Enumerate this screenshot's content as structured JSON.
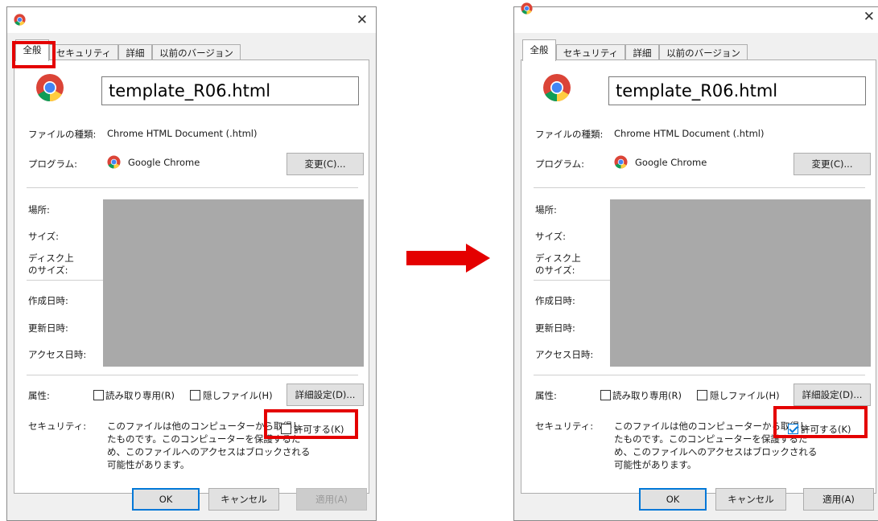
{
  "dialog": {
    "close_glyph": "✕",
    "tabs": [
      "全般",
      "セキュリティ",
      "詳細",
      "以前のバージョン"
    ],
    "file_name": "template_R06.html",
    "labels": {
      "file_type": "ファイルの種類:",
      "program": "プログラム:",
      "location": "場所:",
      "size": "サイズ:",
      "size_on_disk_1": "ディスク上",
      "size_on_disk_2": "のサイズ:",
      "created": "作成日時:",
      "modified": "更新日時:",
      "accessed": "アクセス日時:",
      "attributes": "属性:",
      "security": "セキュリティ:"
    },
    "file_type_value": "Chrome HTML Document (.html)",
    "program_name": "Google Chrome",
    "change_button": "変更(C)...",
    "attr_readonly": "読み取り専用(R)",
    "attr_hidden": "隠しファイル(H)",
    "advanced_button": "詳細設定(D)...",
    "security_text": [
      "このファイルは他のコンピューターから取得し",
      "たものです。このコンピューターを保護するた",
      "め、このファイルへのアクセスはブロックされる",
      "可能性があります。"
    ],
    "unblock_label": "許可する(K)",
    "ok_button": "OK",
    "cancel_button": "キャンセル",
    "apply_button": "適用(A)"
  },
  "state": {
    "before": {
      "unblock_checked": false,
      "apply_enabled": false
    },
    "after": {
      "unblock_checked": true,
      "apply_enabled": true
    }
  },
  "colors": {
    "highlight": "#e40000",
    "arrow": "#e40000",
    "accent": "#0078d7"
  },
  "icons": {
    "app": "chrome-icon",
    "arrow": "right-arrow-icon",
    "close": "close-icon"
  }
}
